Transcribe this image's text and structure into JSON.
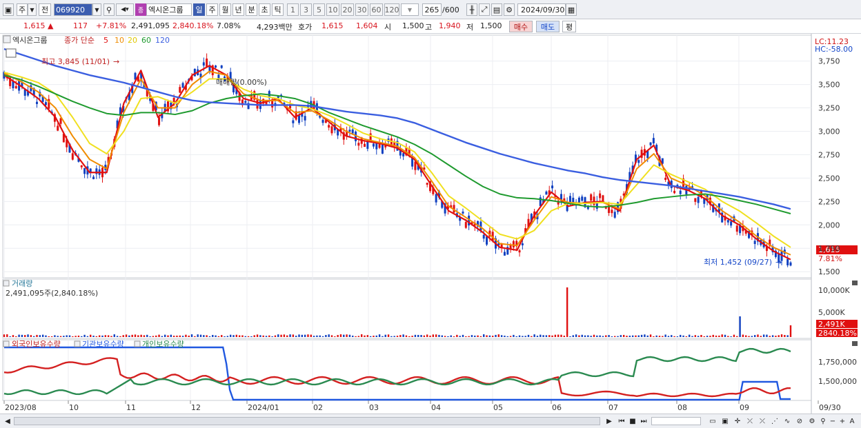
{
  "toolbar": {
    "period": "주",
    "type": "전",
    "code": "069920",
    "name": "엑시온그룹",
    "periods": [
      "일",
      "주",
      "월",
      "년",
      "분",
      "초",
      "틱"
    ],
    "nums": [
      "1",
      "3",
      "5",
      "10",
      "20",
      "30",
      "60",
      "120"
    ],
    "count": "265",
    "total": "/600",
    "date": "2024/09/30"
  },
  "quote": {
    "price": "1,615",
    "change": "117",
    "change_pct": "+7.81%",
    "volume": "2,491,095",
    "volume_pct": "2,840.18%",
    "turnover": "7.08%",
    "amount": "4,293백만",
    "ask_label": "호가",
    "ask": "1,615",
    "bid": "1,604",
    "open_label": "시",
    "open": "1,500",
    "high_label": "고",
    "high": "1,940",
    "low_label": "저",
    "low": "1,500",
    "buy": "매수",
    "sell": "매도",
    "eval": "평"
  },
  "price_panel": {
    "stock_name": "엑시온그룹",
    "ma_label": "종가 단순",
    "ma_periods": [
      "5",
      "10",
      "20",
      "60",
      "120"
    ],
    "lc": "LC:11.23",
    "hc": "HC:-58.00",
    "high_note": "최고 3,845 (11/01)",
    "low_note": "최저 1,452 (09/27)",
    "event_note": "매매량(0.00%)",
    "last_price": "1,615",
    "last_pct": "7.81%",
    "y_ticks": [
      "3,750",
      "3,500",
      "3,250",
      "3,000",
      "2,750",
      "2,500",
      "2,250",
      "2,000",
      "1,750",
      "1,500"
    ]
  },
  "volume_panel": {
    "title": "거래량",
    "sub": "2,491,095주(2,840.18%)",
    "y_ticks": [
      "10,000K",
      "5,000K"
    ],
    "last": "2,491K",
    "last_pct": "2840.18%"
  },
  "holdings_panel": {
    "legend": [
      "외국인보유수량",
      "기관보유수량",
      "개인보유수량"
    ],
    "y_ticks": [
      "1,750,000",
      "1,500,000"
    ]
  },
  "x_axis": [
    "2023/08",
    "10",
    "11",
    "12",
    "2024/01",
    "02",
    "03",
    "04",
    "05",
    "06",
    "07",
    "08",
    "09",
    "09/30"
  ],
  "colors": {
    "ma5": "#e01010",
    "ma10": "#f08c00",
    "ma20": "#f0e020",
    "ma60": "#1e9a2e",
    "ma120": "#3a5ee0",
    "up": "#e01010",
    "down": "#1040c0",
    "foreign": "#d42020",
    "inst": "#2058e0",
    "retail": "#2a8a50"
  },
  "chart_data": {
    "type": "line",
    "y_range_price": [
      1450,
      3880
    ],
    "x_months": [
      "2023/08",
      "10",
      "11",
      "12",
      "2024/01",
      "02",
      "03",
      "04",
      "05",
      "06",
      "07",
      "08",
      "09"
    ],
    "series": [
      {
        "name": "5",
        "values": [
          3600,
          3480,
          3350,
          3150,
          2800,
          2560,
          2560,
          3300,
          3650,
          3150,
          3300,
          3600,
          3700,
          3600,
          3350,
          3300,
          3350,
          3150,
          3250,
          3100,
          2950,
          2900,
          2870,
          2820,
          2700,
          2420,
          2150,
          2050,
          1920,
          1760,
          1730,
          2100,
          2350,
          2200,
          2240,
          2250,
          2150,
          2700,
          2850,
          2420,
          2370,
          2280,
          2100,
          2000,
          1850,
          1720,
          1630
        ]
      },
      {
        "name": "10",
        "values": [
          3620,
          3530,
          3420,
          3250,
          2950,
          2700,
          2600,
          3200,
          3560,
          3250,
          3250,
          3500,
          3640,
          3600,
          3400,
          3330,
          3330,
          3200,
          3220,
          3120,
          3000,
          2920,
          2880,
          2840,
          2720,
          2470,
          2200,
          2080,
          1960,
          1800,
          1780,
          2050,
          2300,
          2240,
          2230,
          2240,
          2170,
          2600,
          2760,
          2500,
          2420,
          2310,
          2150,
          2030,
          1880,
          1760,
          1680
        ]
      },
      {
        "name": "20",
        "values": [
          3630,
          3580,
          3520,
          3400,
          3150,
          2870,
          2760,
          3000,
          3350,
          3370,
          3300,
          3420,
          3560,
          3560,
          3450,
          3380,
          3350,
          3280,
          3240,
          3170,
          3080,
          2980,
          2920,
          2880,
          2780,
          2560,
          2310,
          2180,
          2040,
          1900,
          1850,
          1940,
          2150,
          2230,
          2230,
          2240,
          2220,
          2430,
          2640,
          2540,
          2460,
          2380,
          2250,
          2150,
          2020,
          1880,
          1760
        ]
      },
      {
        "name": "60",
        "values": [
          3600,
          3550,
          3480,
          3400,
          3320,
          3250,
          3190,
          3170,
          3200,
          3200,
          3180,
          3220,
          3300,
          3350,
          3380,
          3400,
          3380,
          3350,
          3290,
          3200,
          3130,
          3060,
          3000,
          2940,
          2860,
          2760,
          2640,
          2520,
          2410,
          2330,
          2290,
          2280,
          2260,
          2230,
          2200,
          2190,
          2210,
          2240,
          2280,
          2300,
          2320,
          2330,
          2300,
          2260,
          2220,
          2170,
          2120
        ]
      },
      {
        "name": "120",
        "values": [
          3880,
          3820,
          3760,
          3700,
          3650,
          3600,
          3560,
          3520,
          3470,
          3420,
          3370,
          3330,
          3310,
          3300,
          3290,
          3280,
          3280,
          3280,
          3270,
          3240,
          3210,
          3190,
          3170,
          3140,
          3090,
          3020,
          2950,
          2880,
          2820,
          2760,
          2710,
          2660,
          2620,
          2580,
          2550,
          2510,
          2480,
          2460,
          2440,
          2420,
          2390,
          2360,
          2330,
          2300,
          2260,
          2220,
          2170
        ]
      }
    ]
  }
}
